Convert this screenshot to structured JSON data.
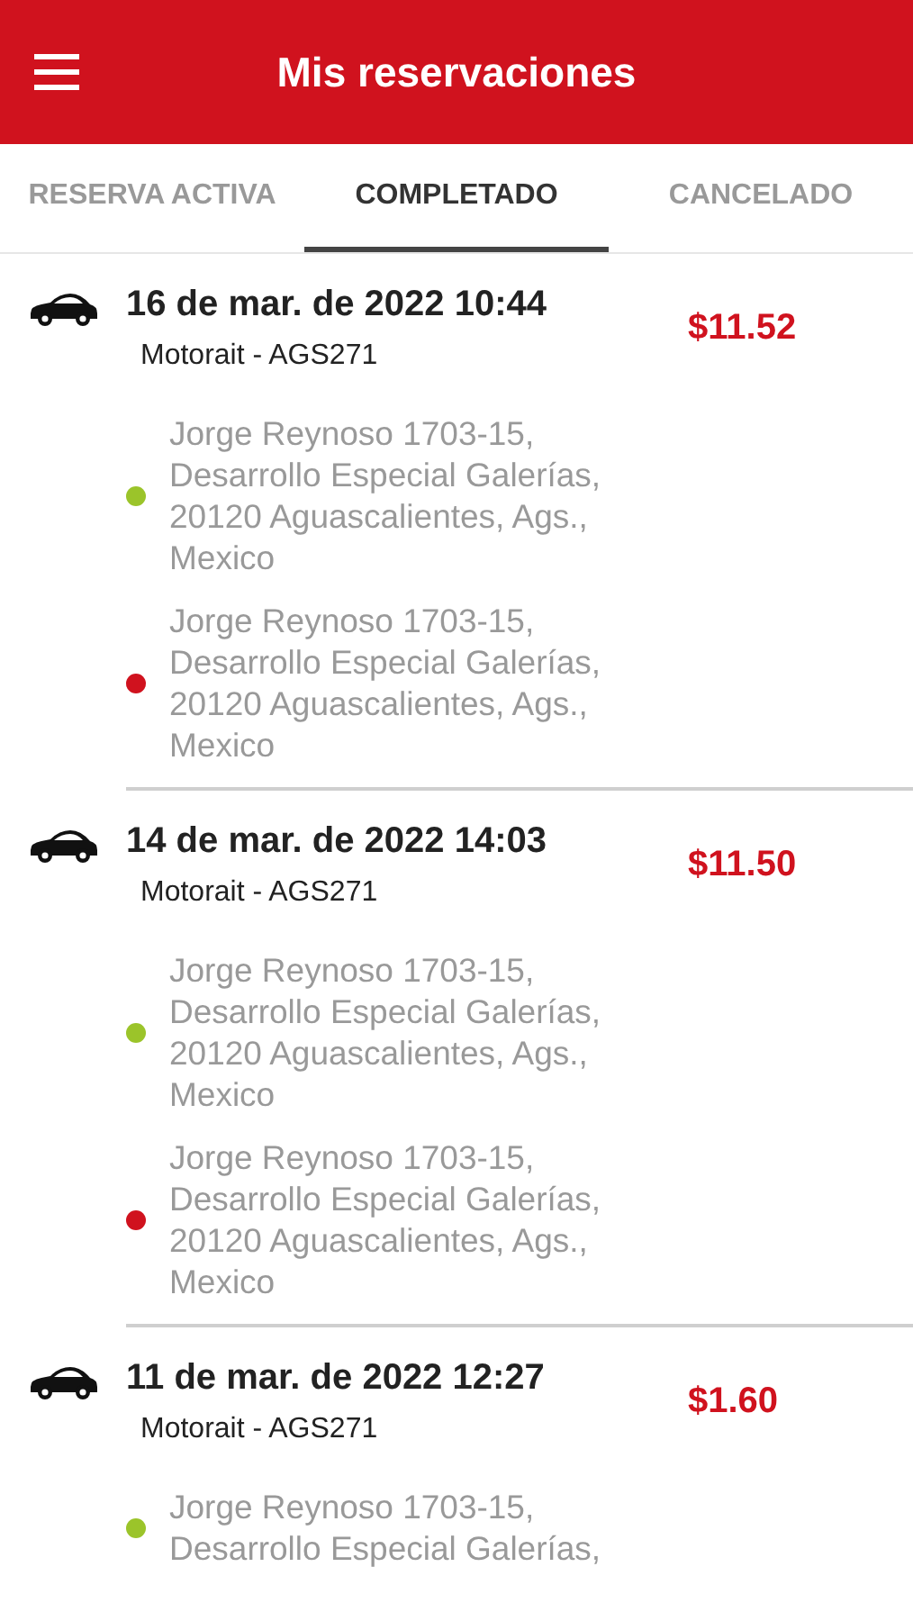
{
  "header": {
    "title": "Mis reservaciones"
  },
  "tabs": [
    {
      "label": "RESERVA ACTIVA",
      "selected": false
    },
    {
      "label": "COMPLETADO",
      "selected": true
    },
    {
      "label": "CANCELADO",
      "selected": false
    }
  ],
  "reservations": [
    {
      "date": "16 de mar. de 2022 10:44",
      "vehicle": "Motorait - AGS271",
      "price": "$11.52",
      "stops": [
        {
          "address": "Jorge Reynoso 1703-15,\nDesarrollo Especial Galerías,\n20120 Aguascalientes, Ags.,\nMexico",
          "color": "#9bc42a"
        },
        {
          "address": "Jorge Reynoso 1703-15,\nDesarrollo Especial Galerías,\n20120 Aguascalientes, Ags.,\nMexico",
          "color": "#d0121e"
        }
      ]
    },
    {
      "date": "14 de mar. de 2022 14:03",
      "vehicle": "Motorait - AGS271",
      "price": "$11.50",
      "stops": [
        {
          "address": "Jorge Reynoso 1703-15,\nDesarrollo Especial Galerías,\n20120 Aguascalientes, Ags.,\nMexico",
          "color": "#9bc42a"
        },
        {
          "address": "Jorge Reynoso 1703-15,\nDesarrollo Especial Galerías,\n20120 Aguascalientes, Ags.,\nMexico",
          "color": "#d0121e"
        }
      ]
    },
    {
      "date": "11 de mar. de 2022 12:27",
      "vehicle": "Motorait - AGS271",
      "price": "$1.60",
      "stops": [
        {
          "address": "Jorge Reynoso 1703-15,\nDesarrollo Especial Galerías,",
          "color": "#9bc42a"
        }
      ]
    }
  ]
}
